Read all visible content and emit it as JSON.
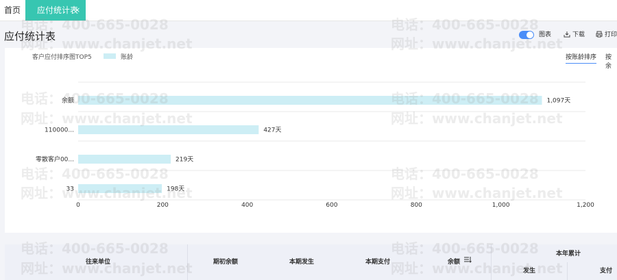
{
  "tabs": {
    "home": "首页",
    "active": "应付统计表",
    "close": "×"
  },
  "page": {
    "title": "应付统计表"
  },
  "toolbar": {
    "chart_label": "图表",
    "download_label": "下载",
    "print_label": "打印"
  },
  "legend": {
    "title": "客户应付排序图TOP5",
    "series_label": "账龄"
  },
  "sort": {
    "by_age": "按账龄排序",
    "by_balance": "按余"
  },
  "watermark": {
    "phone": "电话：400-665-0028",
    "site": "网址：www.chanjet.net"
  },
  "colors": {
    "accent": "#37c6b1",
    "toggle": "#4a8df8",
    "bar": "#cdeef5"
  },
  "chart_data": {
    "type": "bar",
    "orientation": "horizontal",
    "categories": [
      "余额",
      "110000...",
      "零散客户00...",
      "33"
    ],
    "values": [
      1097,
      427,
      219,
      198
    ],
    "value_labels": [
      "1,097天",
      "427天",
      "219天",
      "198天"
    ],
    "x_ticks": [
      "0",
      "200",
      "400",
      "600",
      "800",
      "1,000",
      "1,200"
    ],
    "xlim": [
      0,
      1200
    ],
    "legend": "top-left",
    "grid": true
  },
  "table": {
    "headers": [
      "往来单位",
      "期初余额",
      "本期发生",
      "本期支付",
      "余额"
    ],
    "group_header": "本年累计",
    "sub_headers": [
      "发生",
      "支付"
    ]
  }
}
